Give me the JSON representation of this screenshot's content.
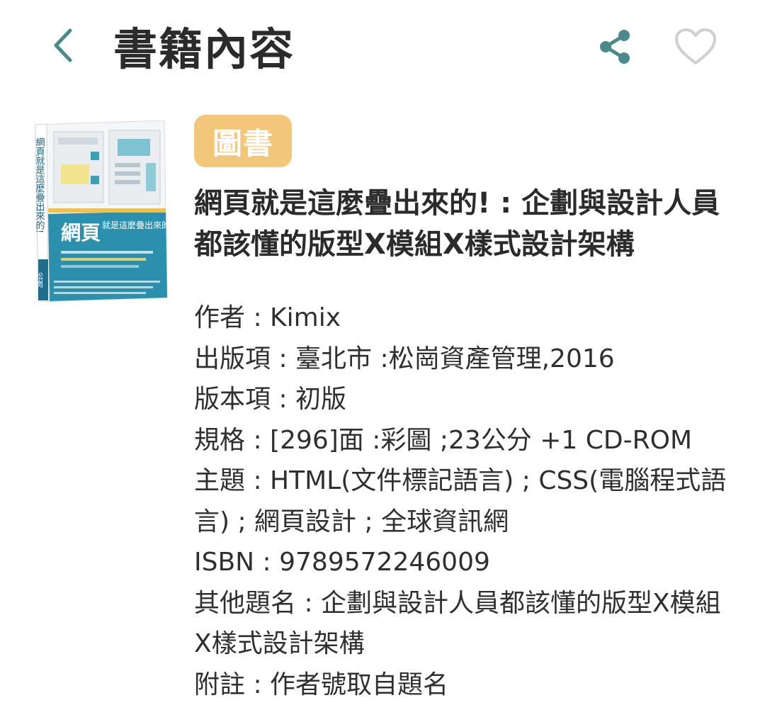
{
  "header": {
    "title": "書籍內容",
    "back_icon": "chevron-left-icon",
    "share_icon": "share-icon",
    "favorite_icon": "heart-outline-icon",
    "accent_color": "#4a8a8c"
  },
  "book": {
    "type_badge": "圖書",
    "badge_color": "#f3c77a",
    "title": "網頁就是這麼疊出來的! : 企劃與設計人員都該懂的版型X模組X樣式設計架構",
    "cover": {
      "vertical_title": "網頁就是這麼疊出來的!",
      "main_word": "網頁",
      "sub_word": "就是這麼疊出來的!",
      "publisher_mark": "松崗"
    },
    "details": [
      {
        "label": "作者",
        "value": "Kimix"
      },
      {
        "label": "出版項",
        "value": "臺北市 :松崗資產管理,2016"
      },
      {
        "label": "版本項",
        "value": "初版"
      },
      {
        "label": "規格",
        "value": "[296]面 :彩圖 ;23公分 +1 CD-ROM"
      },
      {
        "label": "主題",
        "value": "HTML(文件標記語言) ; CSS(電腦程式語言) ; 網頁設計 ; 全球資訊網"
      },
      {
        "label": "ISBN",
        "value": "9789572246009"
      },
      {
        "label": "其他題名",
        "value": "企劃與設計人員都該懂的版型X模組X樣式設計架構"
      },
      {
        "label": "附註",
        "value": "作者號取自題名"
      }
    ],
    "separator": " : "
  }
}
